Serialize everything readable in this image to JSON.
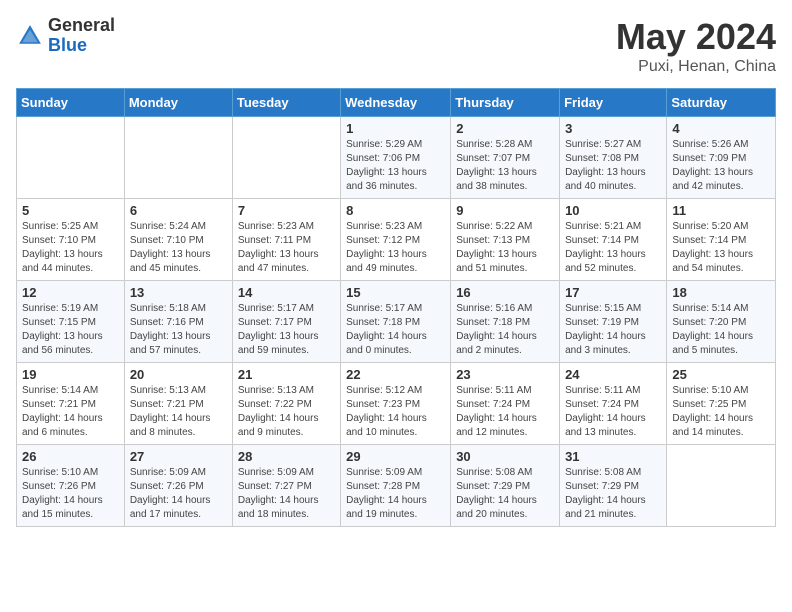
{
  "header": {
    "logo_general": "General",
    "logo_blue": "Blue",
    "title": "May 2024",
    "subtitle": "Puxi, Henan, China"
  },
  "days_of_week": [
    "Sunday",
    "Monday",
    "Tuesday",
    "Wednesday",
    "Thursday",
    "Friday",
    "Saturday"
  ],
  "weeks": [
    [
      {
        "day": null
      },
      {
        "day": null
      },
      {
        "day": null
      },
      {
        "day": "1",
        "sunrise": "5:29 AM",
        "sunset": "7:06 PM",
        "daylight": "13 hours and 36 minutes."
      },
      {
        "day": "2",
        "sunrise": "5:28 AM",
        "sunset": "7:07 PM",
        "daylight": "13 hours and 38 minutes."
      },
      {
        "day": "3",
        "sunrise": "5:27 AM",
        "sunset": "7:08 PM",
        "daylight": "13 hours and 40 minutes."
      },
      {
        "day": "4",
        "sunrise": "5:26 AM",
        "sunset": "7:09 PM",
        "daylight": "13 hours and 42 minutes."
      }
    ],
    [
      {
        "day": "5",
        "sunrise": "5:25 AM",
        "sunset": "7:10 PM",
        "daylight": "13 hours and 44 minutes."
      },
      {
        "day": "6",
        "sunrise": "5:24 AM",
        "sunset": "7:10 PM",
        "daylight": "13 hours and 45 minutes."
      },
      {
        "day": "7",
        "sunrise": "5:23 AM",
        "sunset": "7:11 PM",
        "daylight": "13 hours and 47 minutes."
      },
      {
        "day": "8",
        "sunrise": "5:23 AM",
        "sunset": "7:12 PM",
        "daylight": "13 hours and 49 minutes."
      },
      {
        "day": "9",
        "sunrise": "5:22 AM",
        "sunset": "7:13 PM",
        "daylight": "13 hours and 51 minutes."
      },
      {
        "day": "10",
        "sunrise": "5:21 AM",
        "sunset": "7:14 PM",
        "daylight": "13 hours and 52 minutes."
      },
      {
        "day": "11",
        "sunrise": "5:20 AM",
        "sunset": "7:14 PM",
        "daylight": "13 hours and 54 minutes."
      }
    ],
    [
      {
        "day": "12",
        "sunrise": "5:19 AM",
        "sunset": "7:15 PM",
        "daylight": "13 hours and 56 minutes."
      },
      {
        "day": "13",
        "sunrise": "5:18 AM",
        "sunset": "7:16 PM",
        "daylight": "13 hours and 57 minutes."
      },
      {
        "day": "14",
        "sunrise": "5:17 AM",
        "sunset": "7:17 PM",
        "daylight": "13 hours and 59 minutes."
      },
      {
        "day": "15",
        "sunrise": "5:17 AM",
        "sunset": "7:18 PM",
        "daylight": "14 hours and 0 minutes."
      },
      {
        "day": "16",
        "sunrise": "5:16 AM",
        "sunset": "7:18 PM",
        "daylight": "14 hours and 2 minutes."
      },
      {
        "day": "17",
        "sunrise": "5:15 AM",
        "sunset": "7:19 PM",
        "daylight": "14 hours and 3 minutes."
      },
      {
        "day": "18",
        "sunrise": "5:14 AM",
        "sunset": "7:20 PM",
        "daylight": "14 hours and 5 minutes."
      }
    ],
    [
      {
        "day": "19",
        "sunrise": "5:14 AM",
        "sunset": "7:21 PM",
        "daylight": "14 hours and 6 minutes."
      },
      {
        "day": "20",
        "sunrise": "5:13 AM",
        "sunset": "7:21 PM",
        "daylight": "14 hours and 8 minutes."
      },
      {
        "day": "21",
        "sunrise": "5:13 AM",
        "sunset": "7:22 PM",
        "daylight": "14 hours and 9 minutes."
      },
      {
        "day": "22",
        "sunrise": "5:12 AM",
        "sunset": "7:23 PM",
        "daylight": "14 hours and 10 minutes."
      },
      {
        "day": "23",
        "sunrise": "5:11 AM",
        "sunset": "7:24 PM",
        "daylight": "14 hours and 12 minutes."
      },
      {
        "day": "24",
        "sunrise": "5:11 AM",
        "sunset": "7:24 PM",
        "daylight": "14 hours and 13 minutes."
      },
      {
        "day": "25",
        "sunrise": "5:10 AM",
        "sunset": "7:25 PM",
        "daylight": "14 hours and 14 minutes."
      }
    ],
    [
      {
        "day": "26",
        "sunrise": "5:10 AM",
        "sunset": "7:26 PM",
        "daylight": "14 hours and 15 minutes."
      },
      {
        "day": "27",
        "sunrise": "5:09 AM",
        "sunset": "7:26 PM",
        "daylight": "14 hours and 17 minutes."
      },
      {
        "day": "28",
        "sunrise": "5:09 AM",
        "sunset": "7:27 PM",
        "daylight": "14 hours and 18 minutes."
      },
      {
        "day": "29",
        "sunrise": "5:09 AM",
        "sunset": "7:28 PM",
        "daylight": "14 hours and 19 minutes."
      },
      {
        "day": "30",
        "sunrise": "5:08 AM",
        "sunset": "7:29 PM",
        "daylight": "14 hours and 20 minutes."
      },
      {
        "day": "31",
        "sunrise": "5:08 AM",
        "sunset": "7:29 PM",
        "daylight": "14 hours and 21 minutes."
      },
      {
        "day": null
      }
    ]
  ]
}
